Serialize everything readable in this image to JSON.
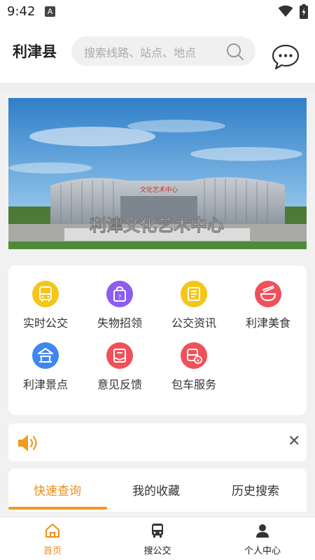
{
  "status_bar": {
    "time": "9:42",
    "notif_letter": "A"
  },
  "header": {
    "city": "利津县",
    "search_placeholder": "搜索线路、站点、地点"
  },
  "banner": {
    "sign_text": "利津文化艺术中心",
    "building_sign": "文化艺术中心"
  },
  "services": [
    {
      "label": "实时公交",
      "icon": "bus-icon",
      "color": "#f5c518"
    },
    {
      "label": "失物招领",
      "icon": "bag-icon",
      "color": "#8e5cf0"
    },
    {
      "label": "公交资讯",
      "icon": "news-icon",
      "color": "#f5c518"
    },
    {
      "label": "利津美食",
      "icon": "food-bowl-icon",
      "color": "#f0505a"
    },
    {
      "label": "利津景点",
      "icon": "pavilion-icon",
      "color": "#3f86f0"
    },
    {
      "label": "意见反馈",
      "icon": "feedback-icon",
      "color": "#f0505a"
    },
    {
      "label": "包车服务",
      "icon": "charter-bus-icon",
      "color": "#f0505a"
    }
  ],
  "tabs": [
    {
      "label": "快速查询",
      "active": true
    },
    {
      "label": "我的收藏",
      "active": false
    },
    {
      "label": "历史搜索",
      "active": false
    }
  ],
  "bottom_nav": [
    {
      "label": "首页",
      "icon": "home-icon",
      "active": true
    },
    {
      "label": "搜公交",
      "icon": "bus-icon",
      "active": false
    },
    {
      "label": "个人中心",
      "icon": "user-icon",
      "active": false
    }
  ],
  "colors": {
    "accent": "#f08c1c",
    "underline": "#f39a21"
  }
}
